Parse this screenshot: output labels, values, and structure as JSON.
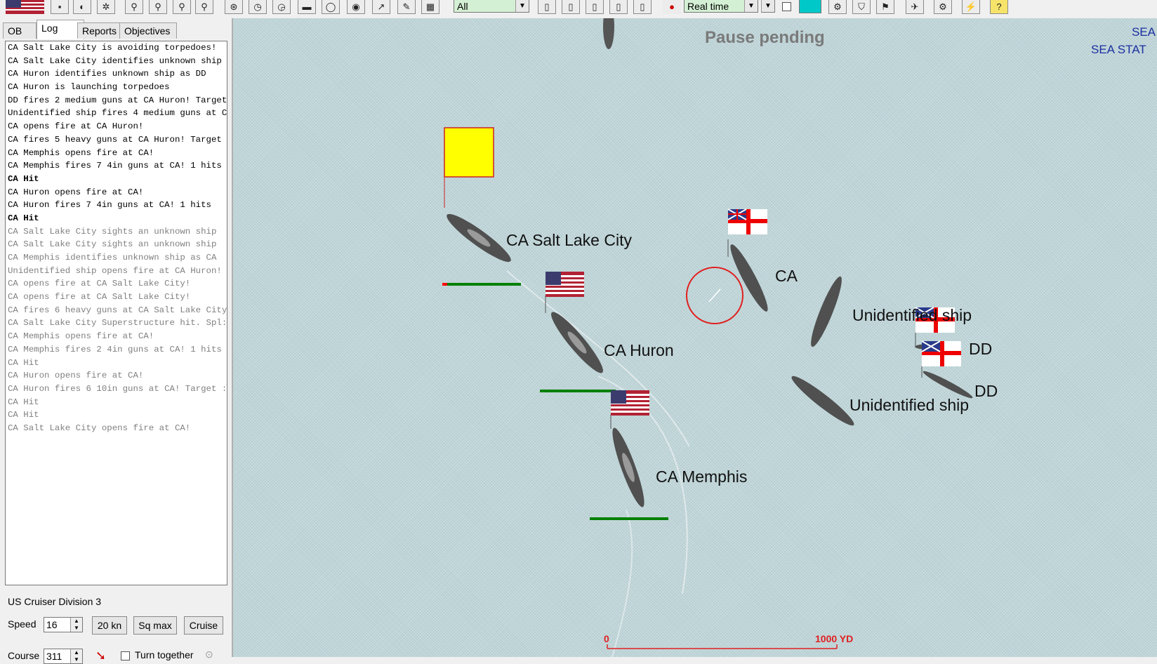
{
  "toolbar": {
    "filter_select": "All",
    "time_select": "Real time",
    "icons": [
      "us-flag-icon",
      "save-icon",
      "bomb-icon",
      "sight-icon",
      "zoom-in-icon",
      "zoom-out-icon",
      "zoom-fit-icon",
      "zoom-icon",
      "ship-icon",
      "clock-icon",
      "clock-step-icon",
      "stop-icon",
      "green-circle-icon",
      "red-circle-icon",
      "torpedo-icon",
      "pencil-icon",
      "ruler-icon",
      "page-icon",
      "gear-icon",
      "shield-icon",
      "flag-icon",
      "plane-icon",
      "settings-icon",
      "lightning-icon",
      "help-icon"
    ]
  },
  "tabs": [
    {
      "label": "OB",
      "active": false
    },
    {
      "label": "Log",
      "active": true
    },
    {
      "label": "Reports",
      "active": false
    },
    {
      "label": "Objectives",
      "active": false
    }
  ],
  "log": [
    {
      "text": "CA Salt Lake City is avoiding torpedoes!",
      "style": "new"
    },
    {
      "text": "CA Salt Lake City identifies unknown ship",
      "style": "new"
    },
    {
      "text": "CA Huron identifies unknown ship as DD",
      "style": "new"
    },
    {
      "text": "CA Huron is launching torpedoes",
      "style": "new"
    },
    {
      "text": "DD fires 2 medium guns at CA Huron! Target",
      "style": "new"
    },
    {
      "text": "Unidentified ship fires 4 medium guns at C",
      "style": "new"
    },
    {
      "text": "CA opens fire at CA Huron!",
      "style": "new"
    },
    {
      "text": "CA fires 5 heavy guns at CA Huron! Target",
      "style": "new"
    },
    {
      "text": "CA Memphis opens fire at CA!",
      "style": "new"
    },
    {
      "text": "CA Memphis fires 7 4in guns at CA! 1 hits",
      "style": "new"
    },
    {
      "text": "CA Hit",
      "style": "bold"
    },
    {
      "text": "CA Huron opens fire at CA!",
      "style": "new"
    },
    {
      "text": "CA Huron fires 7 4in guns at CA! 1 hits",
      "style": "new"
    },
    {
      "text": "CA Hit",
      "style": "bold"
    },
    {
      "text": "CA Salt Lake City sights an unknown ship",
      "style": "old"
    },
    {
      "text": "CA Salt Lake City sights an unknown ship",
      "style": "old"
    },
    {
      "text": "CA Memphis identifies unknown ship as CA",
      "style": "old"
    },
    {
      "text": "Unidentified ship opens fire at CA Huron!",
      "style": "old"
    },
    {
      "text": "CA opens fire at CA Salt Lake City!",
      "style": "old"
    },
    {
      "text": "CA opens fire at CA Salt Lake City!",
      "style": "old"
    },
    {
      "text": "CA fires 6 heavy guns at CA Salt Lake City",
      "style": "old"
    },
    {
      "text": "CA Salt Lake City Superstructure hit. Spl:",
      "style": "old"
    },
    {
      "text": "CA Memphis opens fire at CA!",
      "style": "old"
    },
    {
      "text": "CA Memphis fires 2 4in guns at CA! 1 hits",
      "style": "old"
    },
    {
      "text": "CA Hit",
      "style": "old"
    },
    {
      "text": "CA Huron opens fire at CA!",
      "style": "old"
    },
    {
      "text": "CA Huron fires 6 10in guns at CA! Target :",
      "style": "old"
    },
    {
      "text": "CA Hit",
      "style": "old"
    },
    {
      "text": "CA Hit",
      "style": "old"
    },
    {
      "text": "CA Salt Lake City opens fire at CA!",
      "style": "old"
    }
  ],
  "controls": {
    "division_name": "US Cruiser Division 3",
    "speed_label": "Speed",
    "speed_value": "16",
    "btn_20kn": "20 kn",
    "btn_sqmax": "Sq max",
    "btn_cruise": "Cruise",
    "course_label": "Course",
    "course_value": "311",
    "turn_together_label": "Turn together"
  },
  "map": {
    "pause_text": "Pause pending",
    "sea_text_1": "SEA",
    "sea_text_2": "SEA STAT",
    "ships": {
      "slc": "CA Salt Lake City",
      "huron": "CA Huron",
      "memphis": "CA Memphis",
      "enemy_ca": "CA",
      "unid1": "Unidentified ship",
      "dd1": "DD",
      "unid2": "Unidentified ship",
      "dd2": "DD"
    },
    "scale_start": "0",
    "scale_end": "1000 YD",
    "colors": {
      "health_bar": "#008000",
      "damage": "#ff0000",
      "ship": "#555555",
      "marker": "#ffff00",
      "target_ring": "#e02020"
    }
  }
}
